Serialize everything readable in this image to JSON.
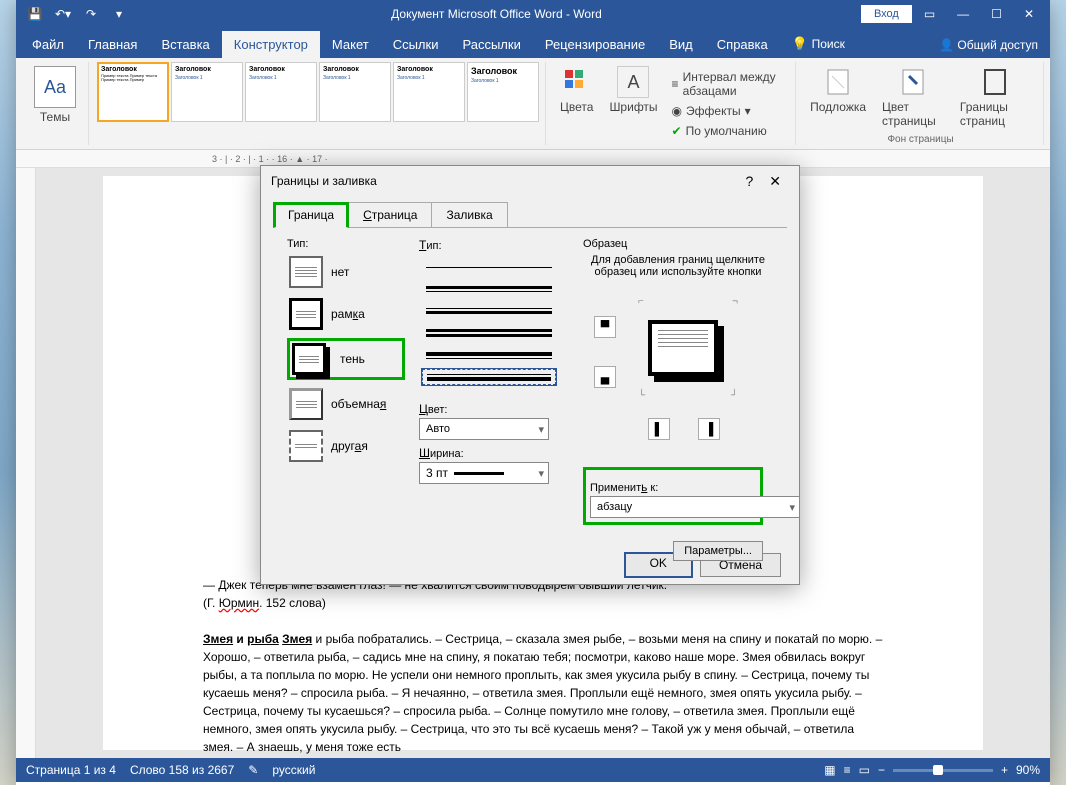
{
  "titlebar": {
    "title": "Документ Microsoft Office Word  -  Word",
    "signin": "Вход"
  },
  "menu": {
    "file": "Файл",
    "home": "Главная",
    "insert": "Вставка",
    "design": "Конструктор",
    "layout": "Макет",
    "references": "Ссылки",
    "mailings": "Рассылки",
    "review": "Рецензирование",
    "view": "Вид",
    "help": "Справка",
    "search": "Поиск",
    "share": "Общий доступ"
  },
  "ribbon": {
    "themes": "Темы",
    "gallery_title": "Заголовок",
    "gallery_sub": "Заголовок 1",
    "colors": "Цвета",
    "fonts": "Шрифты",
    "spacing": "Интервал между абзацами",
    "effects": "Эффекты",
    "default": "По умолчанию",
    "watermark": "Подложка",
    "pagecolor": "Цвет страницы",
    "borders": "Границы страниц",
    "bg_group": "Фон страницы"
  },
  "ruler": "3 · | · 2 · | · 1 ·                                                                                                                 · 16 · ▲ · 17 ·",
  "dialog": {
    "title": "Границы и заливка",
    "tabs": {
      "border": "Граница",
      "page": "Страница",
      "fill": "Заливка"
    },
    "type_label": "Тип:",
    "types": {
      "none": "нет",
      "box": "рамка",
      "shadow": "тень",
      "threed": "объемная",
      "custom": "другая"
    },
    "style_label": "Тип:",
    "color_label": "Цвет:",
    "color_value": "Авто",
    "width_label": "Ширина:",
    "width_value": "3 пт",
    "preview_label": "Образец",
    "preview_text": "Для добавления границ щелкните образец или используйте кнопки",
    "apply_label": "Применить к:",
    "apply_value": "абзацу",
    "params": "Параметры...",
    "ok": "OK",
    "cancel": "Отмена"
  },
  "document": {
    "line1": "— Джек теперь мне взамен глаз! — не хвалится своим поводырем бывший летчик.",
    "line2": "(Г. Юрмин. 152 слова)",
    "story_title": "Змея и рыба Змея",
    "story": " и рыба побратались. – Сестрица, – сказала змея рыбе, – возьми меня на спину и покатай по морю. – Хорошо, – ответила рыба, – садись мне на спину, я покатаю тебя; посмотри, каково наше море. Змея обвилась вокруг рыбы, а та поплыла по морю. Не успели они немного проплыть, как змея укусила рыбу в спину. – Сестрица, почему ты кусаешь меня? – спросила рыба. – Я нечаянно, – ответила змея. Проплыли ещё немного, змея опять укусила рыбу. – Сестрица, почему ты кусаешься? – спросила рыба. – Солнце помутило мне голову, – ответила змея. Проплыли ещё немного, змея опять укусила рыбу. – Сестрица, что это ты всё кусаешь меня? – Такой уж у меня обычай, – ответила змея. – А знаешь, у меня тоже есть"
  },
  "status": {
    "page": "Страница 1 из 4",
    "words": "Слово 158 из 2667",
    "lang": "русский",
    "zoom": "90%"
  }
}
